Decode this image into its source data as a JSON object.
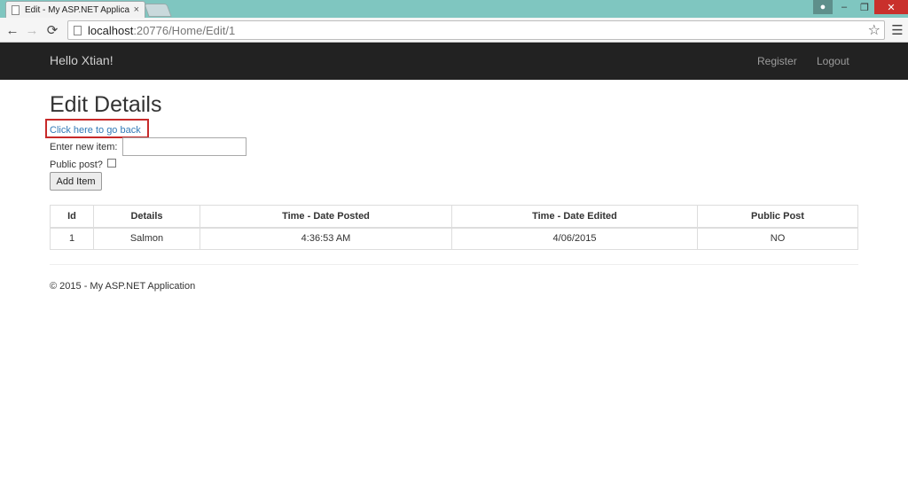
{
  "browser": {
    "tab_title": "Edit - My ASP.NET Applica",
    "tab_close": "×",
    "url_host": "localhost",
    "url_path": ":20776/Home/Edit/1",
    "icons": {
      "back": "arrow-left",
      "forward": "arrow-right",
      "reload": "reload",
      "star": "star",
      "menu": "hamburger"
    }
  },
  "window_controls": {
    "minimize": "‒",
    "maximize": "❐",
    "close": "✕"
  },
  "navbar": {
    "brand": "Hello Xtian!",
    "links": [
      "Register",
      "Logout"
    ]
  },
  "main": {
    "title": "Edit Details",
    "back_link": "Click here to go back",
    "item_label": "Enter new item:",
    "item_value": "",
    "public_label": "Public post?",
    "public_checked": false,
    "add_button": "Add Item"
  },
  "table": {
    "headers": [
      "Id",
      "Details",
      "Time - Date Posted",
      "Time - Date Edited",
      "Public Post"
    ],
    "rows": [
      [
        "1",
        "Salmon",
        "4:36:53 AM",
        "4/06/2015",
        "NO"
      ]
    ]
  },
  "footer": {
    "text": "© 2015 - My ASP.NET Application"
  },
  "colors": {
    "navbar_bg": "#222222",
    "link": "#337ab7",
    "highlight_box": "#c72a2a",
    "titlebar": "#7fc6c0"
  }
}
